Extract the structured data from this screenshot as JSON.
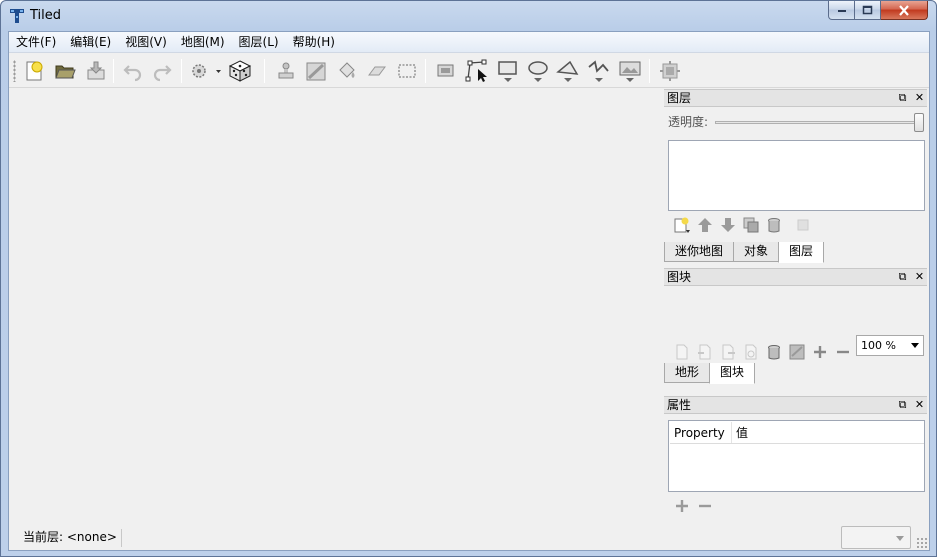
{
  "window": {
    "title": "Tiled",
    "controls": [
      "minimize-icon",
      "maximize-icon",
      "close-icon"
    ]
  },
  "menubar": {
    "items": [
      "文件(F)",
      "编辑(E)",
      "视图(V)",
      "地图(M)",
      "图层(L)",
      "帮助(H)"
    ]
  },
  "toolbar": {
    "icons": [
      "new-map-icon",
      "open-icon",
      "save-icon",
      "undo-icon",
      "redo-icon",
      "commands-icon",
      "random-dice-icon",
      "stamp-brush-icon",
      "terrain-brush-icon",
      "bucket-fill-icon",
      "eraser-icon",
      "rect-select-icon",
      "select-objects-icon",
      "edit-polygons-icon",
      "insert-rectangle-icon",
      "insert-ellipse-icon",
      "insert-polygon-icon",
      "insert-polyline-icon",
      "insert-tile-icon",
      "tile-properties-icon"
    ]
  },
  "layers_panel": {
    "title": "图层",
    "opacity_label": "透明度:",
    "opacity_value": 1.0,
    "tabs": [
      "迷你地图",
      "对象",
      "图层"
    ],
    "active_tab": "图层"
  },
  "tilesets_panel": {
    "title": "图块",
    "zoom": "100 %",
    "tabs": [
      "地形",
      "图块"
    ],
    "active_tab": "图块"
  },
  "properties_panel": {
    "title": "属性",
    "columns": [
      "Property",
      "值"
    ]
  },
  "statusbar": {
    "current_layer": "当前层: <none>"
  },
  "colors": {
    "accent": "#4a8ed8",
    "title_gradient": "#c9d9ee",
    "close_button": "#c13a1f"
  }
}
